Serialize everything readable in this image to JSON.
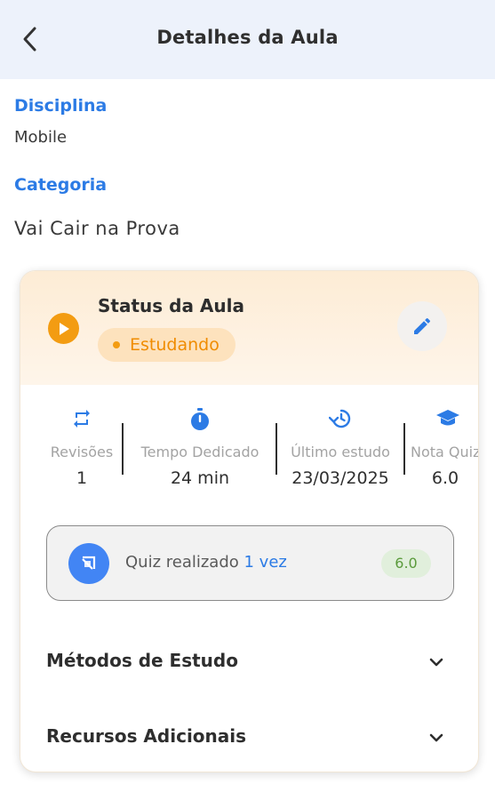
{
  "header": {
    "title": "Detalhes da Aula"
  },
  "disciplina": {
    "label": "Disciplina",
    "value": "Mobile"
  },
  "categoria": {
    "label": "Categoria",
    "value": "Vai Cair na Prova"
  },
  "status_card": {
    "title": "Status da Aula",
    "status": "Estudando",
    "accent_color": "#f39c12"
  },
  "stats": [
    {
      "icon": "repeat-icon",
      "label": "Revisões",
      "value": "1"
    },
    {
      "icon": "timer-icon",
      "label": "Tempo Dedicado",
      "value": "24 min"
    },
    {
      "icon": "history-icon",
      "label": "Último estudo",
      "value": "23/03/2025"
    },
    {
      "icon": "graduation-cap-icon",
      "label": "Nota Quiz",
      "value": "6.0"
    }
  ],
  "quiz": {
    "text": "Quiz realizado ",
    "count": "1 vez",
    "score": "6.0"
  },
  "sections": [
    {
      "title": "Métodos de Estudo"
    },
    {
      "title": "Recursos Adicionais"
    }
  ],
  "colors": {
    "primary": "#2c7be5",
    "orange": "#f39c12",
    "green": "#5a9a3b"
  }
}
